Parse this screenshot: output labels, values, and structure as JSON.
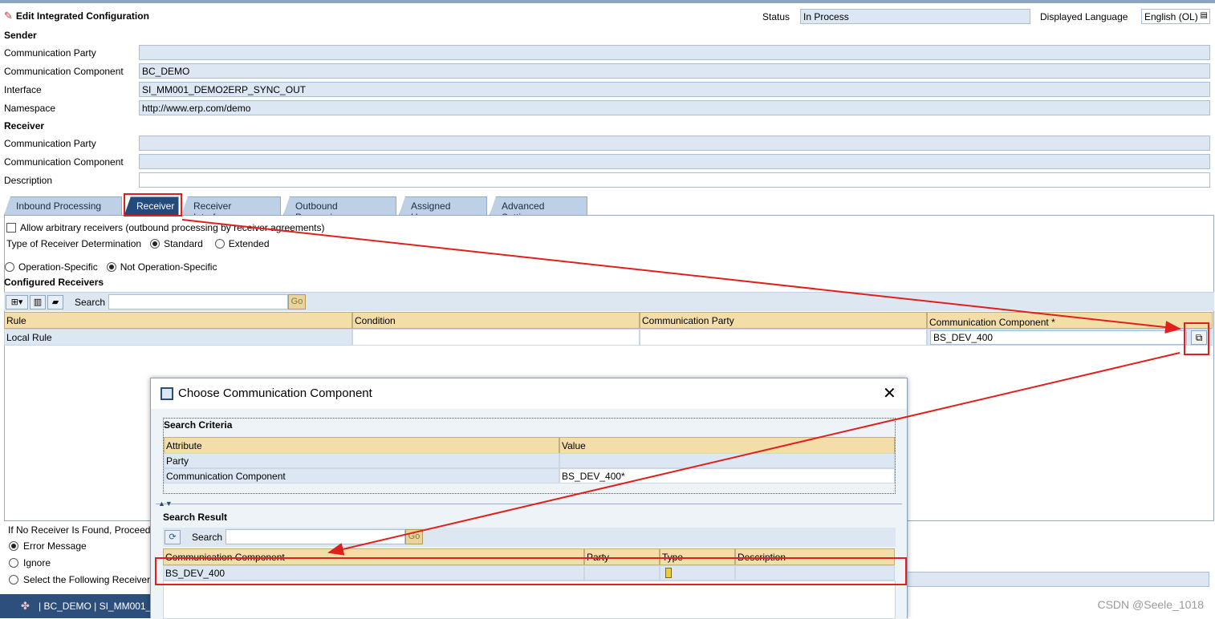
{
  "header": {
    "title": "Edit Integrated Configuration",
    "status_label": "Status",
    "status_value": "In Process",
    "language_label": "Displayed Language",
    "language_value": "English (OL)"
  },
  "sender": {
    "heading": "Sender",
    "party_label": "Communication Party",
    "party_value": "",
    "component_label": "Communication Component",
    "component_value": "BC_DEMO",
    "interface_label": "Interface",
    "interface_value": "SI_MM001_DEMO2ERP_SYNC_OUT",
    "namespace_label": "Namespace",
    "namespace_value": "http://www.erp.com/demo"
  },
  "receiver_section": {
    "heading": "Receiver",
    "party_label": "Communication Party",
    "party_value": "",
    "component_label": "Communication Component",
    "component_value": "",
    "description_label": "Description",
    "description_value": ""
  },
  "tabs": [
    {
      "label": "Inbound Processing"
    },
    {
      "label": "Receiver"
    },
    {
      "label": "Receiver Interfaces"
    },
    {
      "label": "Outbound Processing"
    },
    {
      "label": "Assigned Users"
    },
    {
      "label": "Advanced Settings"
    }
  ],
  "receiver_tab": {
    "allow_arbitrary": "Allow arbitrary receivers (outbound processing by receiver agreements)",
    "type_label": "Type of Receiver Determination",
    "type_standard": "Standard",
    "type_extended": "Extended",
    "op_specific": "Operation-Specific",
    "not_op_specific": "Not Operation-Specific",
    "configured_heading": "Configured Receivers",
    "search_label": "Search",
    "go_label": "Go",
    "columns": [
      "Rule",
      "Condition",
      "Communication Party",
      "Communication Component *"
    ],
    "row": {
      "rule": "Local Rule",
      "condition": "",
      "party": "",
      "component": "BS_DEV_400"
    },
    "no_receiver_label": "If No Receiver Is Found, Proceed",
    "opt_error": "Error Message",
    "opt_ignore": "Ignore",
    "opt_select": "Select the Following Receiver"
  },
  "dialog": {
    "title": "Choose Communication Component",
    "criteria_heading": "Search Criteria",
    "criteria_columns": [
      "Attribute",
      "Value"
    ],
    "criteria_rows": [
      {
        "attribute": "Party",
        "value": ""
      },
      {
        "attribute": "Communication Component",
        "value": "BS_DEV_400*"
      }
    ],
    "result_heading": "Search Result",
    "search_label": "Search",
    "go_label": "Go",
    "result_columns": [
      "Communication Component",
      "Party",
      "Type",
      "Description"
    ],
    "result_rows": [
      {
        "component": "BS_DEV_400",
        "party": "",
        "type": "",
        "description": ""
      }
    ]
  },
  "statusbar": {
    "text": "| BC_DEMO | SI_MM001_"
  },
  "watermark": "CSDN @Seele_1018",
  "colors": {
    "annotation_red": "#e0201c",
    "tab_active": "#244a7c",
    "grid_header": "#f3deaa"
  }
}
